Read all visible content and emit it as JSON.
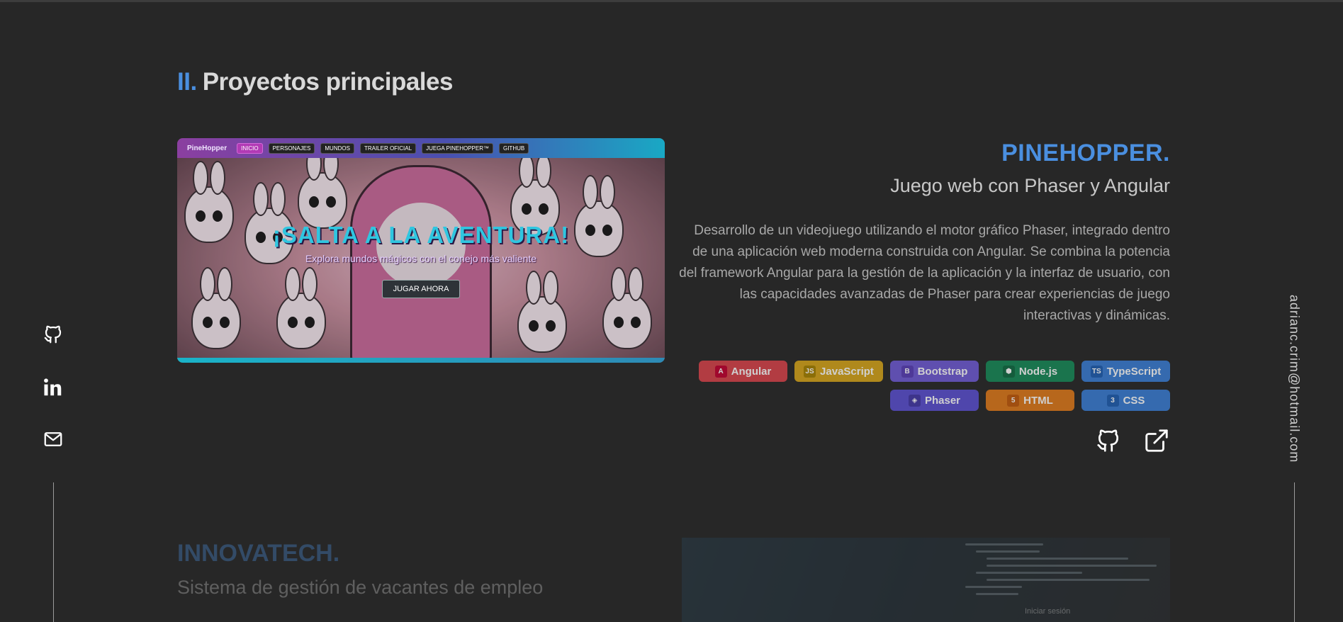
{
  "section": {
    "number": "II.",
    "title": "Proyectos principales"
  },
  "social": {
    "github_icon": "github-icon",
    "linkedin_icon": "linkedin-icon",
    "mail_icon": "mail-icon",
    "email": "adrianc.crim@hotmail.com"
  },
  "project1": {
    "mockup": {
      "logo": "PineHopper",
      "nav": [
        "INICIO",
        "PERSONAJES",
        "MUNDOS",
        "TRAILER OFICIAL",
        "JUEGA PINEHOPPER™",
        "GITHUB"
      ],
      "hero_title": "¡SALTA A LA AVENTURA!",
      "hero_subtitle": "Explora mundos mágicos con el conejo más valiente",
      "hero_button": "JUGAR AHORA"
    },
    "title": "PINEHOPPER.",
    "subtitle": "Juego web con Phaser y Angular",
    "description": "Desarrollo de un videojuego utilizando el motor gráfico Phaser, integrado dentro de una aplicación web moderna construida con Angular. Se combina la potencia del framework Angular para la gestión de la aplicación y la interfaz de usuario, con las capacidades avanzadas de Phaser para crear experiencias de juego interactivas y dinámicas.",
    "tags": [
      {
        "label": "Angular",
        "icon": "A",
        "color": "#d9434a",
        "icon_color": "#c3002f"
      },
      {
        "label": "JavaScript",
        "icon": "JS",
        "color": "#d7a51a",
        "icon_color": "#a88200"
      },
      {
        "label": "Bootstrap",
        "icon": "B",
        "color": "#6f5bd6",
        "icon_color": "#5a3fb8"
      },
      {
        "label": "Node.js",
        "icon": "⬢",
        "color": "#178a58",
        "icon_color": "#0f6b43"
      },
      {
        "label": "TypeScript",
        "icon": "TS",
        "color": "#3a7ed6",
        "icon_color": "#1f5fb3"
      },
      {
        "label": "Phaser",
        "icon": "◈",
        "color": "#5b4fd2",
        "icon_color": "#4438a8"
      },
      {
        "label": "HTML",
        "icon": "5",
        "color": "#e07a1a",
        "icon_color": "#c25a0a"
      },
      {
        "label": "CSS",
        "icon": "3",
        "color": "#3a7ed6",
        "icon_color": "#1f5fb3"
      }
    ],
    "links": {
      "github_icon": "github-icon",
      "external_icon": "external-link-icon"
    }
  },
  "project2": {
    "title": "INNOVATECH.",
    "subtitle": "Sistema de gestión de vacantes de empleo",
    "mockup_text": "Iniciar sesión"
  },
  "colors": {
    "background": "#272727",
    "accent": "#4a8fe0",
    "text_muted": "#a8a8a8"
  }
}
